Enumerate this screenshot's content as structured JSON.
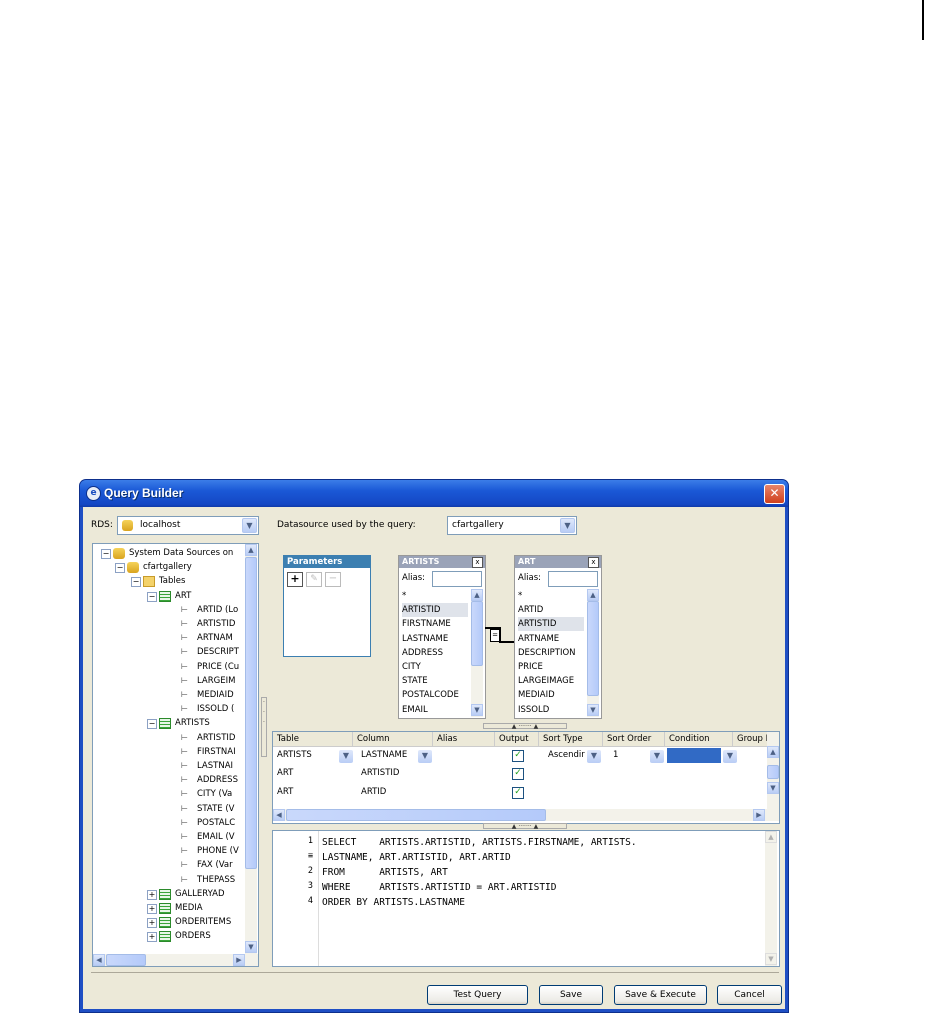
{
  "window": {
    "title": "Query Builder",
    "close_glyph": "✕"
  },
  "rds": {
    "label": "RDS:",
    "value": "localhost"
  },
  "datasource": {
    "label": "Datasource used by the query:",
    "value": "cfartgallery"
  },
  "tree": {
    "root": "System Data Sources on",
    "db": "cfartgallery",
    "tables_folder": "Tables",
    "art_table": "ART",
    "art_columns": [
      "ARTID (Lo",
      "ARTISTID",
      "ARTNAM",
      "DESCRIPT",
      "PRICE (Cu",
      "LARGEIM",
      "MEDIAID",
      "ISSOLD ("
    ],
    "artists_table": "ARTISTS",
    "artists_columns": [
      "ARTISTID",
      "FIRSTNAI",
      "LASTNAI",
      "ADDRESS",
      "CITY (Va",
      "STATE (V",
      "POSTALC",
      "EMAIL (V",
      "PHONE (V",
      "FAX (Var",
      "THEPASS"
    ],
    "other_tables": [
      "GALLERYAD",
      "MEDIA",
      "ORDERITEMS",
      "ORDERS"
    ]
  },
  "parameters": {
    "title": "Parameters",
    "add": "+",
    "edit": "✎",
    "remove": "−"
  },
  "artists_box": {
    "title": "ARTISTS",
    "close": "x",
    "alias_label": "Alias:",
    "fields": [
      "*",
      "ARTISTID",
      "FIRSTNAME",
      "LASTNAME",
      "ADDRESS",
      "CITY",
      "STATE",
      "POSTALCODE",
      "EMAIL"
    ]
  },
  "art_box": {
    "title": "ART",
    "close": "x",
    "alias_label": "Alias:",
    "fields": [
      "*",
      "ARTID",
      "ARTISTID",
      "ARTNAME",
      "DESCRIPTION",
      "PRICE",
      "LARGEIMAGE",
      "MEDIAID",
      "ISSOLD"
    ]
  },
  "join_symbol": "=",
  "grid": {
    "headers": [
      "Table",
      "Column",
      "Alias",
      "Output",
      "Sort Type",
      "Sort Order",
      "Condition",
      "Group B"
    ],
    "rows": [
      {
        "table": "ARTISTS",
        "column": "LASTNAME",
        "output": "✓",
        "sort_type": "Ascendir",
        "sort_order": "1"
      },
      {
        "table": "ART",
        "column": "ARTISTID",
        "output": "✓"
      },
      {
        "table": "ART",
        "column": "ARTID",
        "output": "✓"
      }
    ]
  },
  "sql": {
    "line_numbers": [
      "1",
      "≡",
      "2",
      "3",
      "4"
    ],
    "lines": [
      "SELECT    ARTISTS.ARTISTID, ARTISTS.FIRSTNAME, ARTISTS.",
      "LASTNAME, ART.ARTISTID, ART.ARTID",
      "FROM      ARTISTS, ART",
      "WHERE     ARTISTS.ARTISTID = ART.ARTISTID",
      "ORDER BY ARTISTS.LASTNAME"
    ]
  },
  "buttons": {
    "test": "Test Query",
    "save": "Save",
    "save_execute": "Save & Execute",
    "cancel": "Cancel"
  },
  "icons": {
    "dropdown": "chevron-down-icon",
    "scroll_up": "▲",
    "scroll_down": "▼",
    "scroll_left": "◀",
    "scroll_right": "▶",
    "expand": "+",
    "collapse": "−"
  }
}
